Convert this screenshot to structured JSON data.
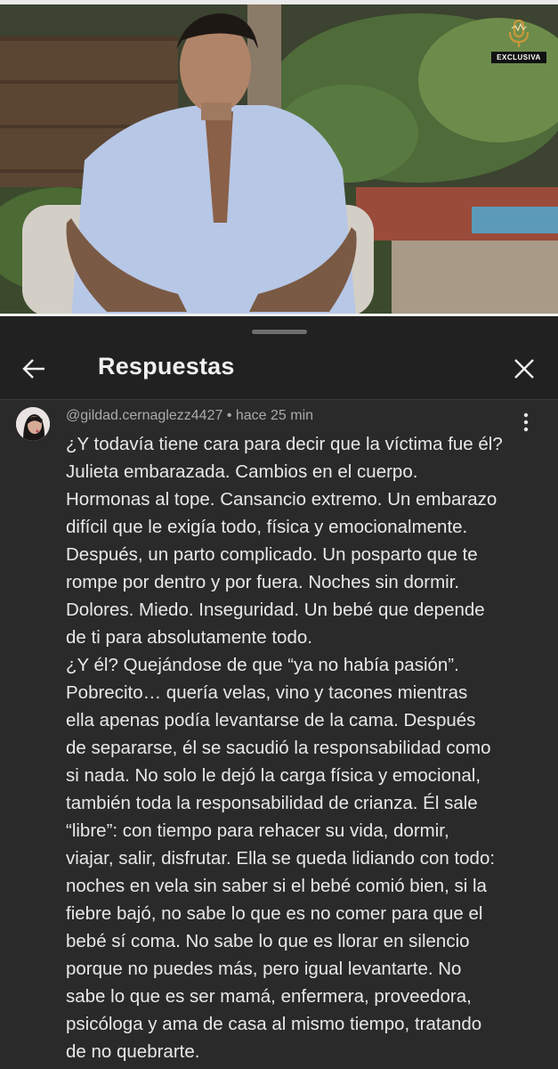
{
  "video": {
    "badge_label": "EXCLUSIVA"
  },
  "sheet": {
    "title": "Respuestas"
  },
  "comment": {
    "author": "@gildad.cernaglezz4427",
    "separator": "•",
    "time": "hace 25 min",
    "lines": [
      "¿Y todavía tiene cara para decir que la víctima fue él?",
      "Julieta embarazada. Cambios en el cuerpo.",
      "Hormonas al tope. Cansancio extremo. Un embarazo",
      "difícil que le exigía todo, física y emocionalmente.",
      "Después, un parto complicado. Un posparto que te",
      "rompe por dentro y por fuera. Noches sin dormir.",
      "Dolores. Miedo. Inseguridad. Un bebé que depende",
      "de ti para absolutamente todo.",
      "¿Y él? Quejándose de que “ya no había pasión”.",
      "Pobrecito… quería velas, vino y tacones mientras",
      "ella apenas podía levantarse de la cama. Después",
      "de separarse, él se sacudió la responsabilidad como",
      "si nada. No solo le dejó la carga física y emocional,",
      "también toda la responsabilidad de crianza. Él sale",
      "“libre”: con tiempo para rehacer su vida, dormir,",
      "viajar, salir, disfrutar. Ella se queda lidiando con todo:",
      "noches en vela sin saber si el bebé comió bien, si la",
      "fiebre bajó, no sabe lo que es no comer para que el",
      "bebé sí coma. No sabe lo que es llorar en silencio",
      "porque no puedes más, pero igual levantarte. No",
      "sabe lo que es ser mamá, enfermera, proveedora,",
      "psicóloga y ama de casa al mismo tiempo, tratando",
      "de no quebrarte."
    ]
  },
  "icons": {
    "back": "arrow-left-icon",
    "close": "close-icon",
    "more": "more-vertical-icon",
    "badge": "microphone-icon"
  },
  "colors": {
    "background": "#212121",
    "comment_background": "#2a2a2a",
    "text": "#e8e8e8",
    "meta": "#aaaaaa",
    "badge_accent": "#c9983a"
  }
}
